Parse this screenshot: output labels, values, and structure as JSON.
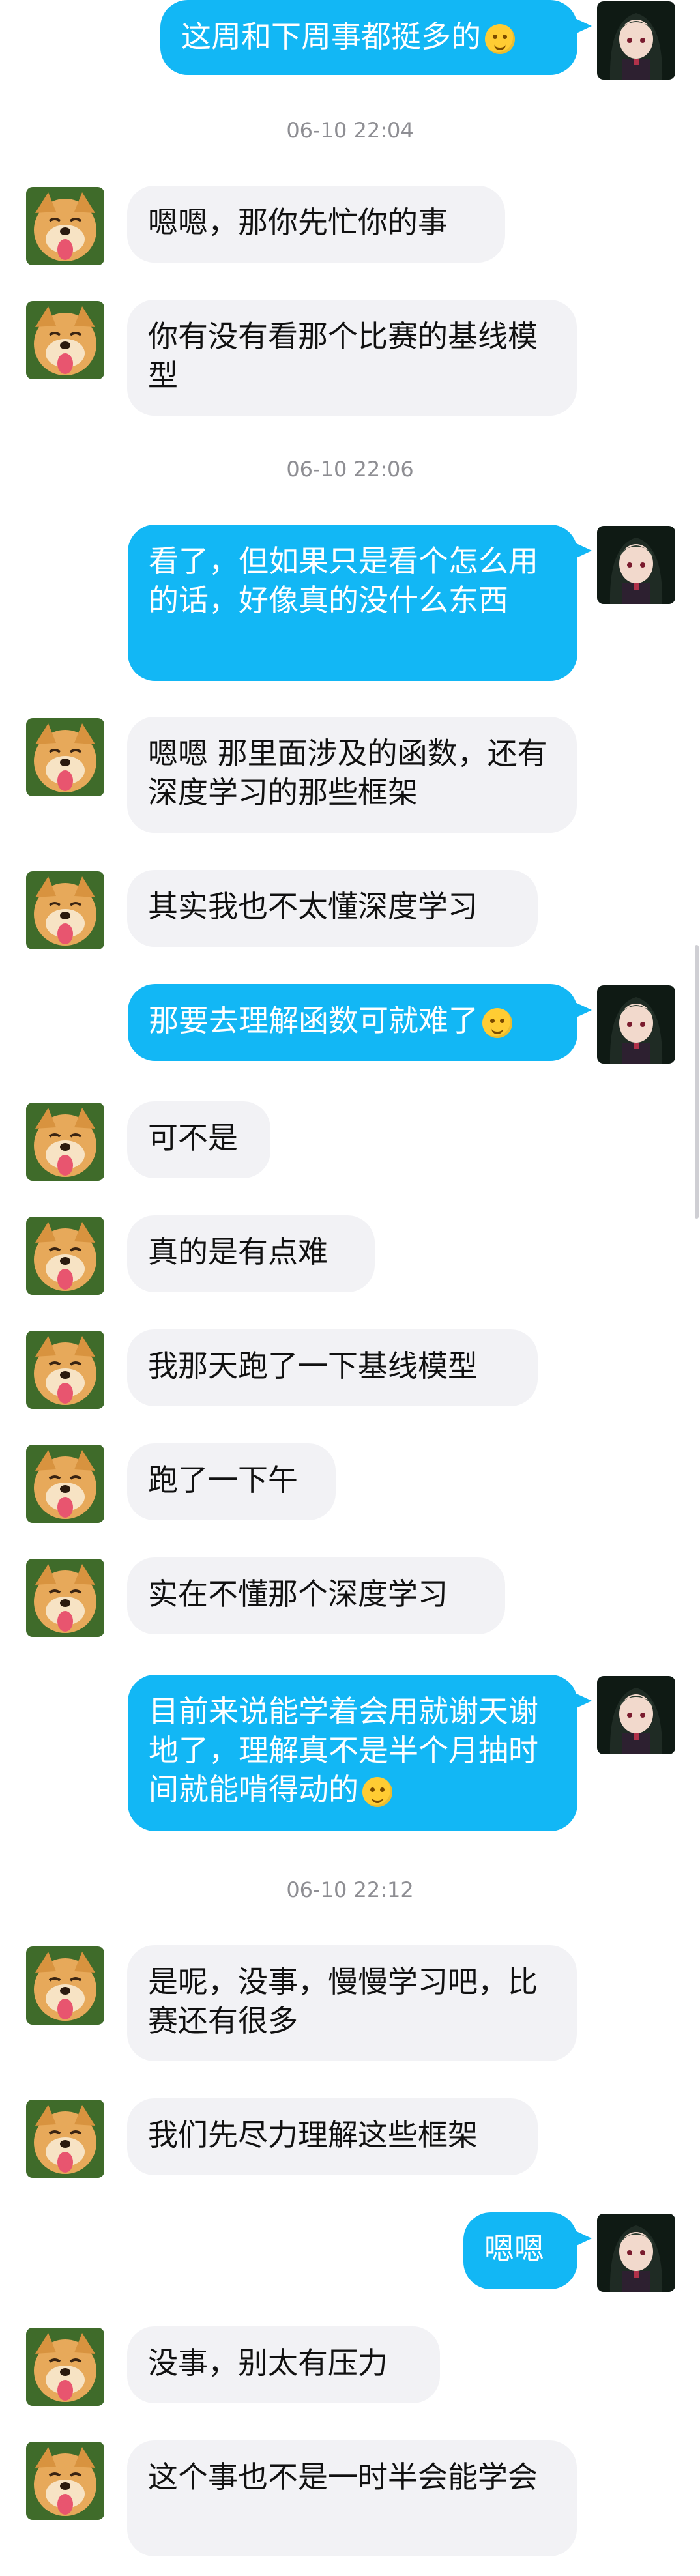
{
  "messages": [
    {
      "type": "out",
      "text": "这周和下周事都挺多的",
      "emoji": "smile-emoji"
    },
    {
      "type": "ts",
      "text": "06-10 22:04"
    },
    {
      "type": "in",
      "text": "嗯嗯，那你先忙你的事"
    },
    {
      "type": "in",
      "text": "你有没有看那个比赛的基线模型"
    },
    {
      "type": "ts",
      "text": "06-10 22:06"
    },
    {
      "type": "out",
      "text": "看了，但如果只是看个怎么用的话，好像真的没什么东西"
    },
    {
      "type": "in",
      "text": "嗯嗯 那里面涉及的函数，还有深度学习的那些框架"
    },
    {
      "type": "in",
      "text": "其实我也不太懂深度学习"
    },
    {
      "type": "out",
      "text": "那要去理解函数可就难了",
      "emoji": "tongue-emoji"
    },
    {
      "type": "in",
      "text": "可不是"
    },
    {
      "type": "in",
      "text": "真的是有点难"
    },
    {
      "type": "in",
      "text": "我那天跑了一下基线模型"
    },
    {
      "type": "in",
      "text": "跑了一下午"
    },
    {
      "type": "in",
      "text": "实在不懂那个深度学习"
    },
    {
      "type": "out",
      "text": "目前来说能学着会用就谢天谢地了，理解真不是半个月抽时间就能啃得动的",
      "emoji": "sweat-emoji"
    },
    {
      "type": "ts",
      "text": "06-10 22:12"
    },
    {
      "type": "in",
      "text": "是呢，没事，慢慢学习吧，比赛还有很多"
    },
    {
      "type": "in",
      "text": "我们先尽力理解这些框架"
    },
    {
      "type": "out",
      "text": "嗯嗯"
    },
    {
      "type": "in",
      "text": "没事，别太有压力"
    },
    {
      "type": "in",
      "text": "这个事也不是一时半会能学会"
    }
  ],
  "colors": {
    "out_bubble": "#12b7f5",
    "in_bubble": "#f2f2f5",
    "timestamp": "#8e8e93"
  }
}
